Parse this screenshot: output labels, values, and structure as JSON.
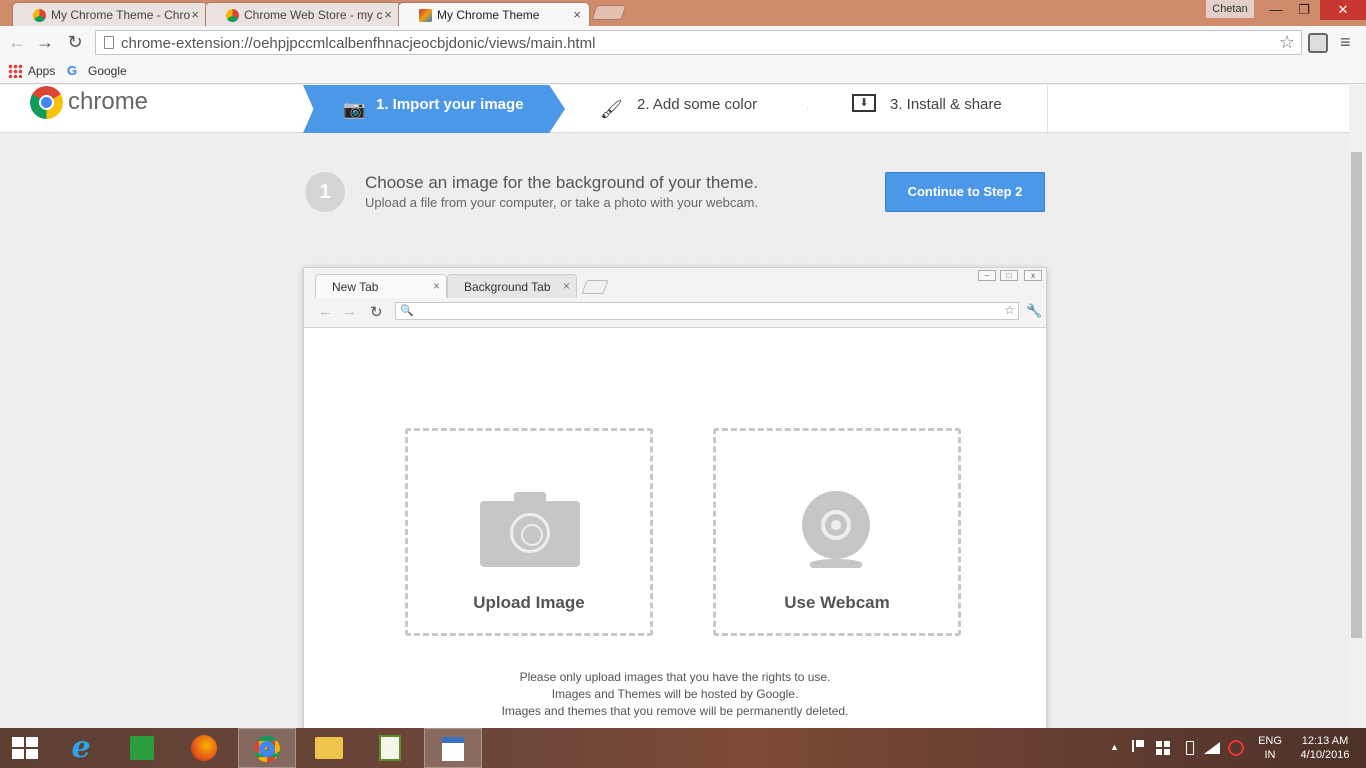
{
  "browser": {
    "tabs": [
      {
        "title": "My Chrome Theme - Chro",
        "close": "×"
      },
      {
        "title": "Chrome Web Store - my c",
        "close": "×"
      },
      {
        "title": "My Chrome Theme",
        "close": "×"
      }
    ],
    "user": "Chetan",
    "window_controls": {
      "minimize": "—",
      "maximize": "❐",
      "close": "✕"
    },
    "nav": {
      "back": "←",
      "forward": "→",
      "reload": "↻"
    },
    "url": "chrome-extension://oehpjpccmlcalbenfhnacjeocbjdonic/views/main.html",
    "star": "☆",
    "menu": "≡",
    "bookmarks": {
      "apps": "Apps",
      "google_g": "G",
      "google": "Google"
    }
  },
  "header": {
    "brand": "chrome",
    "steps": [
      {
        "icon": "camera-icon",
        "icon_glyph": "📷",
        "label": "1. Import your image",
        "active": true
      },
      {
        "icon": "brush-icon",
        "icon_glyph": "🖌",
        "label": "2. Add some color",
        "active": false
      },
      {
        "icon": "install-icon",
        "icon_glyph": "⬇",
        "label": "3. Install & share",
        "active": false
      }
    ]
  },
  "instruction": {
    "number": "1",
    "title": "Choose an image for the background of your theme.",
    "subtitle": "Upload a file from your computer, or take a photo with your webcam.",
    "continue_label": "Continue to Step 2"
  },
  "preview": {
    "tab1": "New Tab",
    "tab2": "Background Tab",
    "tab_close": "×",
    "win": {
      "min": "–",
      "max": "□",
      "close": "x"
    },
    "nav": {
      "back": "←",
      "forward": "→",
      "reload": "↻"
    },
    "search_glyph": "🔍",
    "star": "☆",
    "wrench": "🔧",
    "upload_label": "Upload Image",
    "webcam_label": "Use Webcam",
    "notices": [
      "Please only upload images that you have the rights to use.",
      "Images and Themes will be hosted by Google.",
      "Images and themes that you remove will be permanently deleted."
    ]
  },
  "taskbar": {
    "ie_glyph": "e",
    "tray_arrow": "▲",
    "lang": [
      "ENG",
      "IN"
    ],
    "time": "12:13 AM",
    "date": "4/10/2016"
  },
  "colors": {
    "accent": "#4a98e7",
    "titlebar": "#d08a6c"
  }
}
